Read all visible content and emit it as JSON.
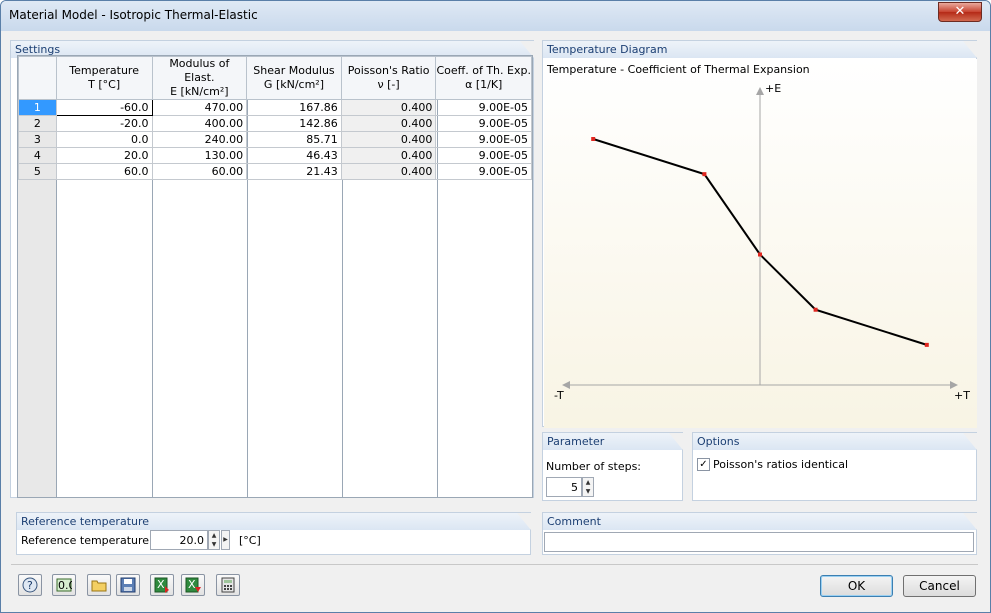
{
  "window": {
    "title": "Material Model - Isotropic Thermal-Elastic",
    "close_glyph": "✕"
  },
  "settings": {
    "heading": "Settings",
    "columns": [
      {
        "line1": "Temperature",
        "line2": "T [°C]"
      },
      {
        "line1": "Modulus of Elast.",
        "line2": "E [kN/cm²]"
      },
      {
        "line1": "Shear Modulus",
        "line2": "G [kN/cm²]"
      },
      {
        "line1": "Poisson's Ratio",
        "line2": "ν [-]"
      },
      {
        "line1": "Coeff. of Th. Exp.",
        "line2": "α [1/K]"
      }
    ],
    "rows": [
      {
        "n": "1",
        "cells": [
          "-60.0",
          "470.00",
          "167.86",
          "0.400",
          "9.00E-05"
        ]
      },
      {
        "n": "2",
        "cells": [
          "-20.0",
          "400.00",
          "142.86",
          "0.400",
          "9.00E-05"
        ]
      },
      {
        "n": "3",
        "cells": [
          "0.0",
          "240.00",
          "85.71",
          "0.400",
          "9.00E-05"
        ]
      },
      {
        "n": "4",
        "cells": [
          "20.0",
          "130.00",
          "46.43",
          "0.400",
          "9.00E-05"
        ]
      },
      {
        "n": "5",
        "cells": [
          "60.0",
          "60.00",
          "21.43",
          "0.400",
          "9.00E-05"
        ]
      }
    ]
  },
  "diagram": {
    "heading": "Temperature Diagram",
    "subtitle": "Temperature - Coefficient of Thermal Expansion",
    "axis_y_label": "+E",
    "axis_x_neg_label": "-T",
    "axis_x_pos_label": "+T",
    "line_color": "#000000",
    "point_color": "#e0261f"
  },
  "chart_data": {
    "type": "line",
    "title": "Temperature - Coefficient of Thermal Expansion",
    "xlabel": "+T",
    "ylabel": "+E",
    "series": [
      {
        "x": [
          -60,
          -20,
          0,
          20,
          60
        ],
        "values": [
          470,
          400,
          240,
          130,
          60
        ]
      }
    ]
  },
  "parameter": {
    "heading": "Parameter",
    "steps_label": "Number of steps:",
    "steps_value": "5"
  },
  "options": {
    "heading": "Options",
    "poisson_identical_label": "Poisson's ratios identical",
    "poisson_identical_checked": true,
    "check_glyph": "✓"
  },
  "reference": {
    "heading": "Reference temperature",
    "label": "Reference temperature:",
    "value": "20.0",
    "unit": "[°C]"
  },
  "comment": {
    "heading": "Comment",
    "value": ""
  },
  "buttons": {
    "ok": "OK",
    "cancel": "Cancel"
  },
  "toolbar_icons": [
    "help-icon",
    "units-icon",
    "open-icon",
    "save-icon",
    "import-excel-icon",
    "export-excel-icon",
    "calculator-icon"
  ]
}
